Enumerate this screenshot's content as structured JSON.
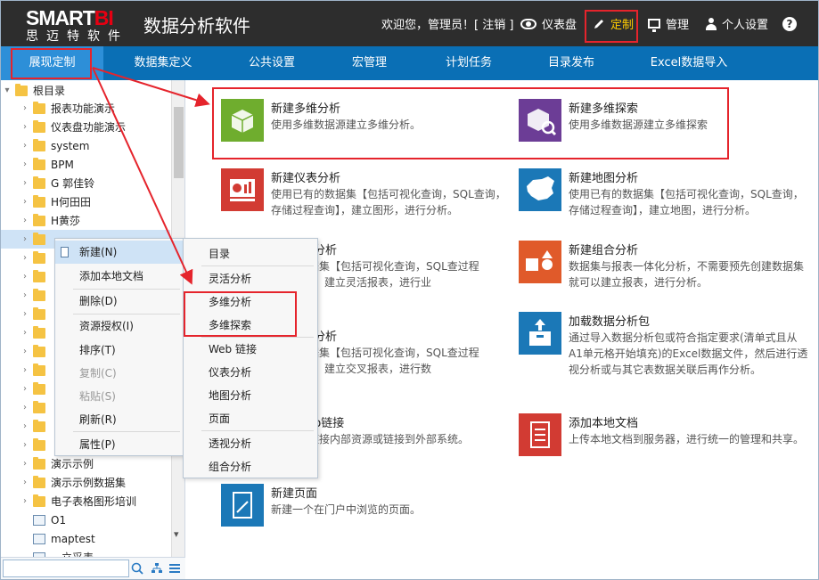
{
  "brand": {
    "logo_main_a": "SMART",
    "logo_main_b": "BI",
    "logo_sub": "思迈特软件",
    "app_title": "数据分析软件"
  },
  "header": {
    "welcome": "欢迎您，管理员！[ 注销 ]",
    "dashboard": "仪表盘",
    "customize": "定制",
    "manage": "管理",
    "personal": "个人设置",
    "help": "?"
  },
  "nav": {
    "tabs": [
      "展现定制",
      "数据集定义",
      "公共设置",
      "宏管理",
      "计划任务",
      "目录发布",
      "Excel数据导入"
    ],
    "active": "展现定制"
  },
  "tree": {
    "root": "根目录",
    "items": [
      "报表功能演示",
      "仪表盘功能演示",
      "system",
      "BPM",
      "G 郭佳铃",
      "H何田田",
      "H黄莎",
      "",
      "",
      "",
      "",
      "",
      "",
      "",
      "",
      "",
      "",
      "",
      "",
      "",
      "演示示例",
      "演示示例数据集",
      "电子表格图形培训",
      "O1",
      "maptest",
      "…立采表"
    ]
  },
  "context_menu": {
    "items": [
      "新建(N)",
      "添加本地文档",
      "删除(D)",
      "资源授权(I)",
      "排序(T)",
      "复制(C)",
      "粘贴(S)",
      "刷新(R)",
      "属性(P)"
    ]
  },
  "submenu": {
    "items": [
      "目录",
      "灵活分析",
      "多维分析",
      "多维探索",
      "Web 链接",
      "仪表分析",
      "地图分析",
      "页面",
      "透视分析",
      "组合分析"
    ]
  },
  "cards": {
    "olap": {
      "title": "新建多维分析",
      "desc": "使用多维数据源建立多维分析。"
    },
    "explore": {
      "title": "新建多维探索",
      "desc": "使用多维数据源建立多维探索"
    },
    "gauge": {
      "title": "新建仪表分析",
      "desc": "使用已有的数据集【包括可视化查询，SQL查询，存储过程查询】，建立图形，进行分析。"
    },
    "map": {
      "title": "新建地图分析",
      "desc": "使用已有的数据集【包括可视化查询，SQL查询，存储过程查询】，建立地图，进行分析。"
    },
    "flex": {
      "title": "分析",
      "desc": "的数据集【包括可视化查询，SQL查过程查询】，建立灵活报表，进行业"
    },
    "combo": {
      "title": "新建组合分析",
      "desc": "数据集与报表一体化分析，不需要预先创建数据集就可以建立报表，进行分析。"
    },
    "cross": {
      "title": "分析",
      "desc": "的数据集【包括可视化查询，SQL查过程查询】，建立交叉报表，进行数"
    },
    "package": {
      "title": "加载数据分析包",
      "desc": "通过导入数据分析包或符合指定要求(清单式且从A1单元格开始填充)的Excel数据文件，然后进行透视分析或与其它表数据关联后再作分析。"
    },
    "web": {
      "title": "b链接",
      "desc": "可链接内部资源或链接到外部系统。"
    },
    "localdoc": {
      "title": "添加本地文档",
      "desc": "上传本地文档到服务器，进行统一的管理和共享。"
    },
    "page": {
      "title": "新建页面",
      "desc": "新建一个在门户中浏览的页面。"
    }
  },
  "colors": {
    "header_bg": "#2d2d2d",
    "nav_bg": "#0a6fb5",
    "nav_active": "#2d8fd8",
    "highlight_red": "#e5242c",
    "green": "#6fad2e",
    "purple": "#6c3d96",
    "red": "#d23b33",
    "blue": "#1b78b7",
    "orange": "#e05a2a"
  }
}
